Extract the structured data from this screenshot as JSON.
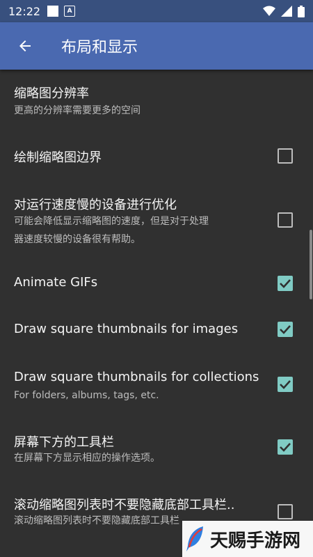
{
  "status_bar": {
    "time": "12:22",
    "notification_glyph": "A",
    "icons": [
      "wifi-icon",
      "signal-icon",
      "battery-icon"
    ]
  },
  "app_bar": {
    "title": "布局和显示",
    "back_icon": "arrow-back-icon",
    "color": "#4a69b0"
  },
  "settings": [
    {
      "title": "缩略图分辨率",
      "subtitle": "更高的分辨率需要更多的空间",
      "checkbox": null
    },
    {
      "title": "绘制缩略图边界",
      "subtitle": "",
      "checkbox": false
    },
    {
      "title": "对运行速度慢的设备进行优化",
      "subtitle_lines": [
        "可能会降低显示缩略图的速度，但是对于处理",
        "器速度较慢的设备很有帮助。"
      ],
      "checkbox": false
    },
    {
      "title": "Animate GIFs",
      "subtitle": "",
      "checkbox": true
    },
    {
      "title": "Draw square thumbnails for images",
      "subtitle": "",
      "checkbox": true
    },
    {
      "title": "Draw square thumbnails for collections",
      "subtitle": "For folders, albums, tags, etc.",
      "checkbox": true
    },
    {
      "title": "屏幕下方的工具栏",
      "subtitle": "在屏幕下方显示相应的操作选项。",
      "checkbox": true
    },
    {
      "title": "滚动缩略图列表时不要隐藏底部工具栏..",
      "subtitle": "滚动缩略图列表时不要隐藏底部工具栏",
      "checkbox": false
    }
  ],
  "watermark": {
    "text": "天赐手游网",
    "logo": "feather-logo-icon"
  },
  "colors": {
    "background": "#303030",
    "accent": "#80cbc4",
    "status_bar": "#38507e"
  }
}
